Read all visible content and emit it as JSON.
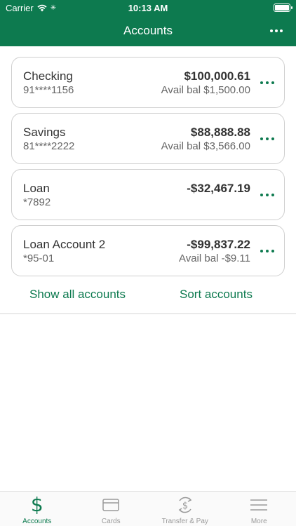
{
  "status_bar": {
    "carrier": "Carrier",
    "time": "10:13 AM"
  },
  "nav": {
    "title": "Accounts",
    "more_icon": "ellipsis-icon"
  },
  "accounts": [
    {
      "name": "Checking",
      "number": "91****1156",
      "balance": "$100,000.61",
      "available": "Avail bal $1,500.00"
    },
    {
      "name": "Savings",
      "number": "81****2222",
      "balance": "$88,888.88",
      "available": "Avail bal $3,566.00"
    },
    {
      "name": "Loan",
      "number": "*7892",
      "balance": "-$32,467.19",
      "available": ""
    },
    {
      "name": "Loan Account 2",
      "number": "*95-01",
      "balance": "-$99,837.22",
      "available": "Avail bal -$9.11"
    }
  ],
  "actions": {
    "show_all": "Show all accounts",
    "sort": "Sort accounts"
  },
  "tabs": [
    {
      "label": "Accounts",
      "icon": "dollar-icon",
      "active": true
    },
    {
      "label": "Cards",
      "icon": "card-icon",
      "active": false
    },
    {
      "label": "Transfer & Pay",
      "icon": "transfer-pay-icon",
      "active": false
    },
    {
      "label": "More",
      "icon": "menu-icon",
      "active": false
    }
  ],
  "colors": {
    "brand": "#0d7a4f",
    "tab_inactive": "#999999"
  }
}
